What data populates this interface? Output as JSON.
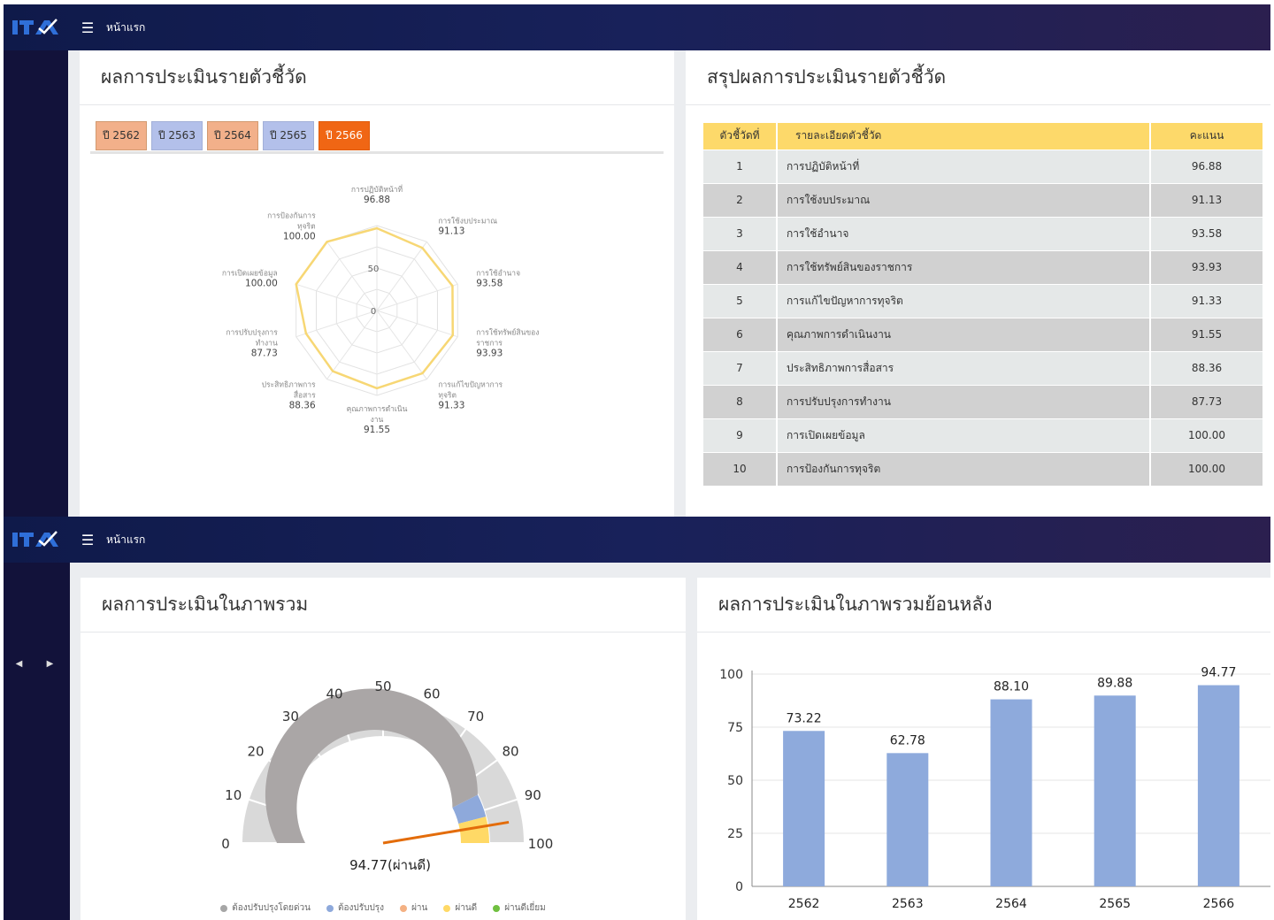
{
  "app": {
    "logo_text": "ITA",
    "home_label": "หน้าแรก"
  },
  "indicator_panel": {
    "title": "ผลการประเมินรายตัวชี้วัด",
    "year_tabs": [
      {
        "label": "ปี 2562",
        "style": "orange"
      },
      {
        "label": "ปี 2563",
        "style": "blue"
      },
      {
        "label": "ปี 2564",
        "style": "orange"
      },
      {
        "label": "ปี 2565",
        "style": "blue"
      },
      {
        "label": "ปี 2566",
        "style": "active"
      }
    ]
  },
  "radar": {
    "axis_ticks": [
      "0",
      "50"
    ],
    "scale_max": 100,
    "line_color": "#f7d774",
    "indicators": [
      {
        "label": [
          "การปฏิบัติหน้าที่"
        ],
        "value": 96.88,
        "display": "96.88"
      },
      {
        "label": [
          "การใช้งบประมาณ"
        ],
        "value": 91.13,
        "display": "91.13"
      },
      {
        "label": [
          "การใช้อำนาจ"
        ],
        "value": 93.58,
        "display": "93.58"
      },
      {
        "label": [
          "การใช้ทรัพย์สินของ",
          "ราชการ"
        ],
        "value": 93.93,
        "display": "93.93"
      },
      {
        "label": [
          "การแก้ไขปัญหาการ",
          "ทุจริต"
        ],
        "value": 91.33,
        "display": "91.33"
      },
      {
        "label": [
          "คุณภาพการดำเนิน",
          "งาน"
        ],
        "value": 91.55,
        "display": "91.55"
      },
      {
        "label": [
          "ประสิทธิภาพการ",
          "สื่อสาร"
        ],
        "value": 88.36,
        "display": "88.36"
      },
      {
        "label": [
          "การปรับปรุงการ",
          "ทำงาน"
        ],
        "value": 87.73,
        "display": "87.73"
      },
      {
        "label": [
          "การเปิดเผยข้อมูล"
        ],
        "value": 100.0,
        "display": "100.00"
      },
      {
        "label": [
          "การป้องกันการ",
          "ทุจริต"
        ],
        "value": 100.0,
        "display": "100.00"
      }
    ]
  },
  "summary_panel": {
    "title": "สรุปผลการประเมินรายตัวชี้วัด",
    "headers": [
      "ตัวชี้วัดที่",
      "รายละเอียดตัวชี้วัด",
      "คะแนน"
    ],
    "rows": [
      {
        "no": "1",
        "name": "การปฏิบัติหน้าที่",
        "score": "96.88"
      },
      {
        "no": "2",
        "name": "การใช้งบประมาณ",
        "score": "91.13"
      },
      {
        "no": "3",
        "name": "การใช้อำนาจ",
        "score": "93.58"
      },
      {
        "no": "4",
        "name": "การใช้ทรัพย์สินของราชการ",
        "score": "93.93"
      },
      {
        "no": "5",
        "name": "การแก้ไขปัญหาการทุจริต",
        "score": "91.33"
      },
      {
        "no": "6",
        "name": "คุณภาพการดำเนินงาน",
        "score": "91.55"
      },
      {
        "no": "7",
        "name": "ประสิทธิภาพการสื่อสาร",
        "score": "88.36"
      },
      {
        "no": "8",
        "name": "การปรับปรุงการทำงาน",
        "score": "87.73"
      },
      {
        "no": "9",
        "name": "การเปิดเผยข้อมูล",
        "score": "100.00"
      },
      {
        "no": "10",
        "name": "การป้องกันการทุจริต",
        "score": "100.00"
      }
    ]
  },
  "overall_panel": {
    "title": "ผลการประเมินในภาพรวม",
    "gauge_value": 94.77,
    "gauge_label": "94.77(ผ่านดี)",
    "gauge_ticks": [
      "0",
      "10",
      "20",
      "30",
      "40",
      "50",
      "60",
      "70",
      "80",
      "90",
      "100"
    ],
    "bands": [
      {
        "from": 0,
        "to": 85,
        "color": "#aaa6a6"
      },
      {
        "from": 85,
        "to": 92,
        "color": "#8ea9db"
      },
      {
        "from": 92,
        "to": 100,
        "color": "#ffd966"
      }
    ],
    "needle_color": "#e36c0a",
    "legend": [
      {
        "label": "ต้องปรับปรุงโดยด่วน",
        "color": "#a6a6a6"
      },
      {
        "label": "ต้องปรับปรุง",
        "color": "#8ea9db"
      },
      {
        "label": "ผ่าน",
        "color": "#f4b183"
      },
      {
        "label": "ผ่านดี",
        "color": "#ffd966"
      },
      {
        "label": "ผ่านดีเยี่ยม",
        "color": "#70c040"
      }
    ]
  },
  "history_panel": {
    "title": "ผลการประเมินในภาพรวมย้อนหลัง"
  },
  "chart_data": {
    "type": "bar",
    "categories": [
      "2562",
      "2563",
      "2564",
      "2565",
      "2566"
    ],
    "values": [
      73.22,
      62.78,
      88.1,
      89.88,
      94.77
    ],
    "labels": [
      "73.22",
      "62.78",
      "88.10",
      "89.88",
      "94.77"
    ],
    "y_ticks": [
      "0",
      "25",
      "50",
      "75",
      "100"
    ],
    "ylim": [
      0,
      100
    ],
    "bar_color": "#8eaadc",
    "grid": true
  }
}
